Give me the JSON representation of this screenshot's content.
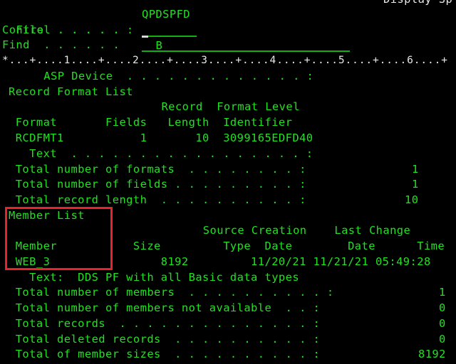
{
  "header": {
    "screen_title": "Display Sp",
    "file_label": "File  . . . . . :",
    "file_value": "QPDSPFD",
    "control_label": "Control . . . . .",
    "control_value": "B",
    "find_label": "Find  . . . . . .",
    "find_value": ""
  },
  "ruler": "*...+....1....+....2....+....3....+....4....+....5....+....6....+",
  "asp_device": {
    "label": "      ASP Device  . . . . . . . . . . . . . :",
    "value": ""
  },
  "record_format_list": {
    "title": "Record Format List",
    "header_line1": "                       Record  Format Level",
    "header_line2": " Format       Fields   Length  Identifier",
    "rows": [
      {
        "format": "RCDFMT1",
        "fields": "1",
        "length": "10",
        "identifier": "3099165EDFD40",
        "line": " RCDFMT1           1       10  3099165EDFD40"
      }
    ],
    "text_label": "   Text  . . . . . . . . . . . . . . . . . :",
    "text_value": ""
  },
  "format_totals": [
    {
      "label": " Total number of formats  . . . . . . . . :",
      "value": "1"
    },
    {
      "label": " Total number of fields . . . . . . . . . :",
      "value": "1"
    },
    {
      "label": " Total record length  . . . . . . . . . . :",
      "value": "10"
    }
  ],
  "member_list": {
    "title": "Member List",
    "header_line1": "                             Source Creation    Last Change",
    "header_line2": " Member           Size         Type  Date        Date      Time",
    "rows": [
      {
        "member": "WEB_3",
        "size": "8192",
        "source_type": "",
        "creation_date": "11/20/21",
        "change_date": "11/21/21",
        "change_time": "05:49:28",
        "line": " WEB_3                8192         11/20/21 11/21/21 05:49:28"
      }
    ],
    "text_line": "   Text:  DDS PF with all Basic data types"
  },
  "member_totals": [
    {
      "label": " Total number of members  . . . . . . . . . . :",
      "value": "1"
    },
    {
      "label": " Total number of members not available  . . :",
      "value": "0"
    },
    {
      "label": " Total records  . . . . . . . . . . . . . . :",
      "value": "0"
    },
    {
      "label": " Total deleted records  . . . . . . . . . . :",
      "value": "0"
    },
    {
      "label": " Total of member sizes  . . . . . . . . . . :",
      "value": "8192"
    }
  ],
  "colors": {
    "text": "#22e022",
    "ruler": "#e8e8e8",
    "highlight": "#e8232b",
    "background": "#000000"
  }
}
